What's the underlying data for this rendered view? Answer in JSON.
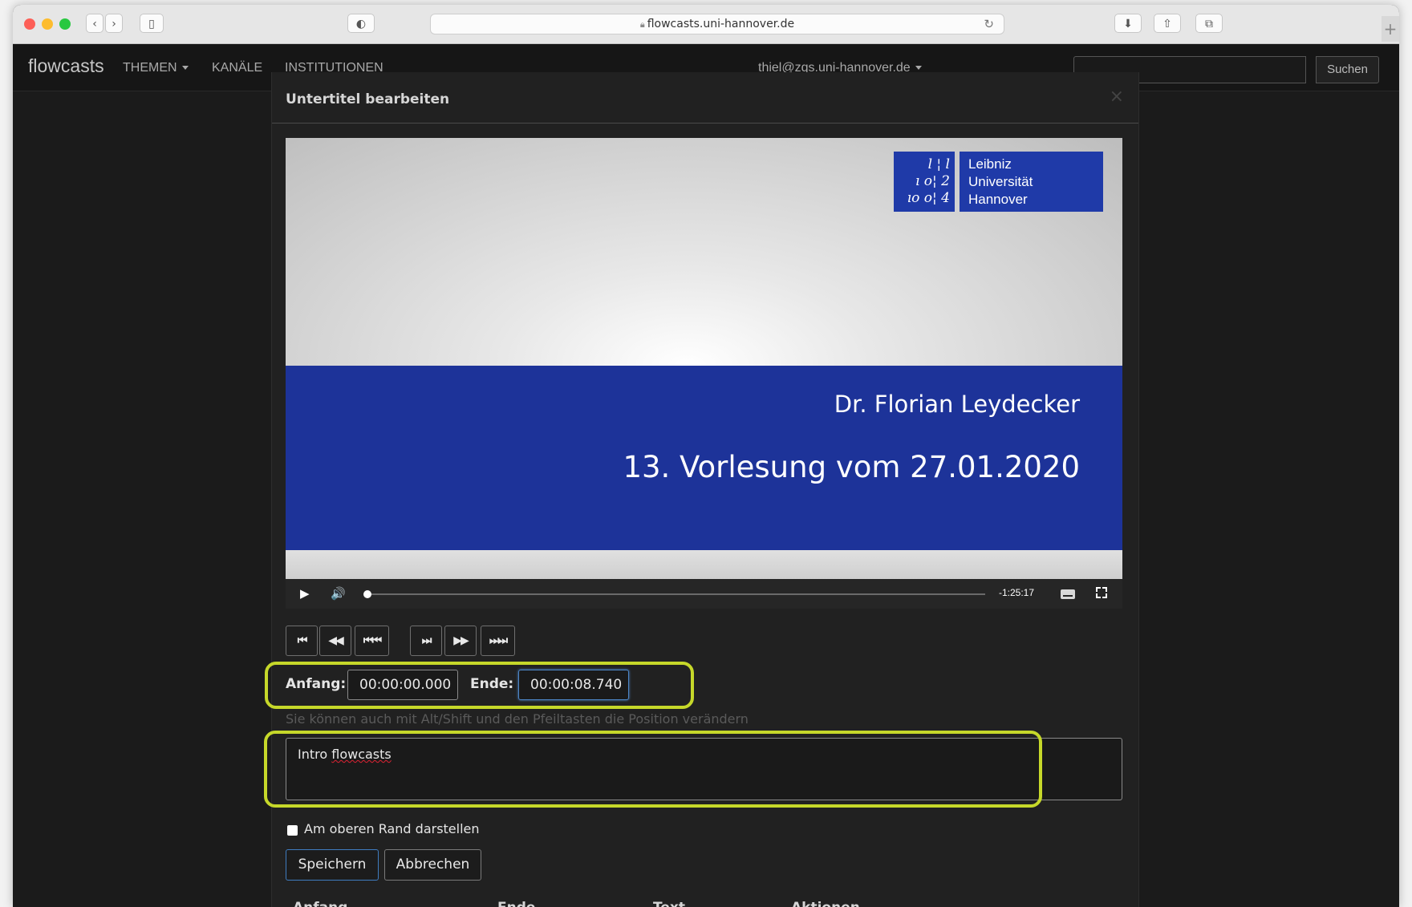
{
  "browser": {
    "url": "flowcasts.uni-hannover.de",
    "back_glyph": "‹",
    "forward_glyph": "›",
    "sidebar_glyph": "▯",
    "shield_glyph": "◐",
    "reload_glyph": "↻",
    "download_glyph": "⬇",
    "share_glyph": "⇧",
    "tabs_glyph": "⧉",
    "newtab_glyph": "+"
  },
  "navbar": {
    "brand": "flowcasts",
    "themen": "THEMEN",
    "kanaele": "KANÄLE",
    "institutionen": "INSTITUTIONEN",
    "user": "thiel@zqs.uni-hannover.de",
    "search_placeholder": "",
    "search_button": "Suchen"
  },
  "modal": {
    "title": "Untertitel bearbeiten",
    "close_glyph": "×",
    "video": {
      "logo_digits_lines": [
        "l ¦ l",
        "ı o¦ 2",
        "ıo o¦ 4"
      ],
      "logo_text_lines": [
        "Leibniz",
        "Universität",
        "Hannover"
      ],
      "speaker": "Dr. Florian Leydecker",
      "lecture": "13. Vorlesung vom 27.01.2020",
      "remaining_time": "-1:25:17",
      "progress": 0.0,
      "play_glyph": "▶",
      "volume_glyph": "🔊"
    },
    "seek_buttons": [
      {
        "name": "seek-start-button",
        "glyph": "⏮"
      },
      {
        "name": "seek-back-button",
        "glyph": "◀◀"
      },
      {
        "name": "seek-back-far-button",
        "glyph": "⏮⏮"
      },
      {
        "name": "seek-end-button",
        "glyph": "⏭"
      },
      {
        "name": "seek-forward-button",
        "glyph": "▶▶"
      },
      {
        "name": "seek-forward-far-button",
        "glyph": "⏭⏭"
      }
    ],
    "anfang_label": "Anfang:",
    "anfang_value": "00:00:00.000",
    "ende_label": "Ende:",
    "ende_value": "00:00:08.740",
    "hint": "Sie können auch mit Alt/Shift und den Pfeiltasten die Position verändern",
    "subtitle_text_a": "Intro ",
    "subtitle_text_b": "flowcasts",
    "checkbox_label": "Am oberen Rand darstellen",
    "checkbox_checked": false,
    "save_button": "Speichern",
    "cancel_button": "Abbrechen",
    "table_headers": [
      "Anfang",
      "Ende",
      "Text",
      "Aktionen"
    ]
  },
  "colors": {
    "highlight": "#c6d82a",
    "video_band": "#1d3399",
    "focus_border": "#4d86c7"
  }
}
